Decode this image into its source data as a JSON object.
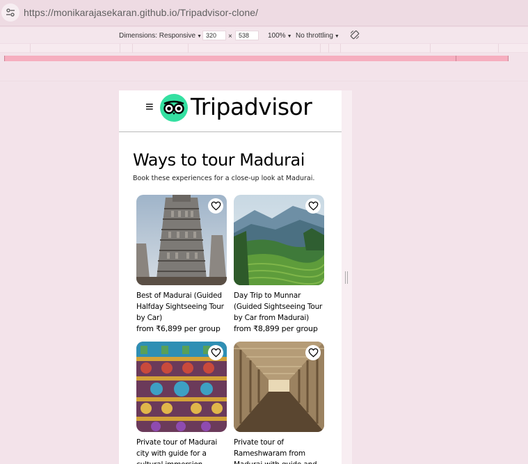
{
  "browser": {
    "url": "https://monikarajasekaran.github.io/Tripadvisor-clone/"
  },
  "devtools": {
    "dimensions_label": "Dimensions: Responsive",
    "width_value": "320",
    "times": "×",
    "height_value": "538",
    "zoom": "100%",
    "throttling": "No throttling"
  },
  "site": {
    "logo_text": "Tripadvisor",
    "menu_glyph": "≡",
    "accent_color": "#34e0a1"
  },
  "section": {
    "title": "Ways to tour Madurai",
    "subtitle": "Book these experiences for a close-up look at Madurai."
  },
  "cards": [
    {
      "title": "Best of Madurai (Guided Halfday Sightseeing Tour by Car)",
      "price": "from ₹6,899 per group",
      "image": "temple-tower-photo"
    },
    {
      "title": "Day Trip to Munnar (Guided Sightseeing Tour by Car from Madurai)",
      "price": "from ₹8,899 per group",
      "image": "tea-hills-photo"
    },
    {
      "title": "Private tour of Madurai city with guide for a cultural immersion",
      "price": "",
      "image": "temple-sculptures-photo"
    },
    {
      "title": "Private tour of Rameshwaram from Madurai with guide and",
      "price": "",
      "image": "temple-corridor-photo"
    }
  ]
}
